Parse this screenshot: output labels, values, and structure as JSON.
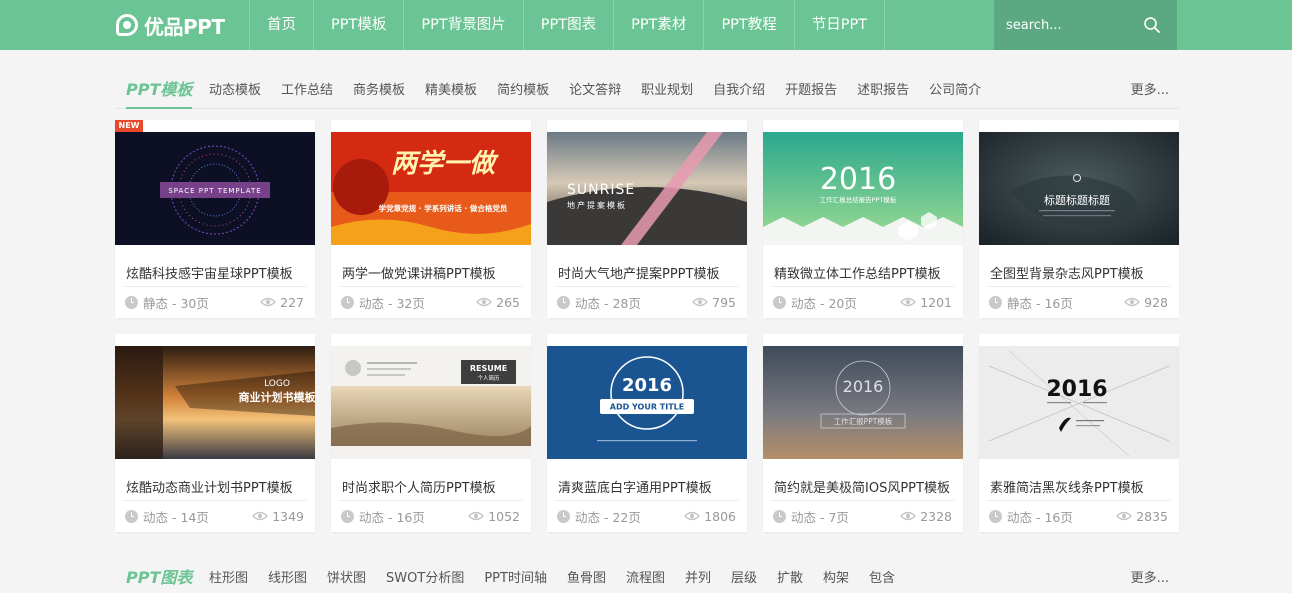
{
  "brand": {
    "name": "优品PPT"
  },
  "nav": {
    "items": [
      "首页",
      "PPT模板",
      "PPT背景图片",
      "PPT图表",
      "PPT素材",
      "PPT教程",
      "节日PPT"
    ]
  },
  "search": {
    "placeholder": "search..."
  },
  "sections": [
    {
      "title": "PPT模板",
      "tags": [
        "动态模板",
        "工作总结",
        "商务模板",
        "精美模板",
        "简约模板",
        "论文答辩",
        "职业规划",
        "自我介绍",
        "开题报告",
        "述职报告",
        "公司简介"
      ],
      "more": "更多..."
    },
    {
      "title": "PPT图表",
      "tags": [
        "柱形图",
        "线形图",
        "饼状图",
        "SWOT分析图",
        "PPT时间轴",
        "鱼骨图",
        "流程图",
        "并列",
        "层级",
        "扩散",
        "构架",
        "包含"
      ],
      "more": "更多..."
    }
  ],
  "badge": "NEW",
  "cards": [
    {
      "title": "炫酷科技感宇宙星球PPT模板",
      "meta": "静态 - 30页",
      "views": "227",
      "thumb_text": "SPACE PPT TEMPLATE"
    },
    {
      "title": "两学一做党课讲稿PPT模板",
      "meta": "动态 - 32页",
      "views": "265",
      "thumb_text": "两学一做",
      "thumb_sub": "学党章党规 · 学系列讲话 · 做合格党员"
    },
    {
      "title": "时尚大气地产提案PPPT模板",
      "meta": "动态 - 28页",
      "views": "795",
      "thumb_text": "SUNRISE",
      "thumb_sub": "地产提案模板"
    },
    {
      "title": "精致微立体工作总结PPT模板",
      "meta": "动态 - 20页",
      "views": "1201",
      "thumb_text": "2016",
      "thumb_sub": "工作汇报总结报告PPT模板"
    },
    {
      "title": "全图型背景杂志风PPT模板",
      "meta": "静态 - 16页",
      "views": "928",
      "thumb_text": "标题标题标题"
    },
    {
      "title": "炫酷动态商业计划书PPT模板",
      "meta": "动态 - 14页",
      "views": "1349",
      "thumb_text": "商业计划书模板",
      "thumb_sub": "LOGO"
    },
    {
      "title": "时尚求职个人简历PPT模板",
      "meta": "动态 - 16页",
      "views": "1052",
      "thumb_text": "RESUME",
      "thumb_sub": "个人简历"
    },
    {
      "title": "清爽蓝底白字通用PPT模板",
      "meta": "动态 - 22页",
      "views": "1806",
      "thumb_text": "2016",
      "thumb_sub": "ADD YOUR TITLE"
    },
    {
      "title": "简约就是美极简IOS风PPT模板",
      "meta": "动态 - 7页",
      "views": "2328",
      "thumb_text": "2016",
      "thumb_sub": "工作汇报PPT模板"
    },
    {
      "title": "素雅简洁黑灰线条PPT模板",
      "meta": "动态 - 16页",
      "views": "2835",
      "thumb_text": "2016"
    }
  ],
  "colors": {
    "brand": "#6bc493",
    "search_bg": "#5ca883",
    "text": "#333333",
    "muted": "#999999"
  }
}
